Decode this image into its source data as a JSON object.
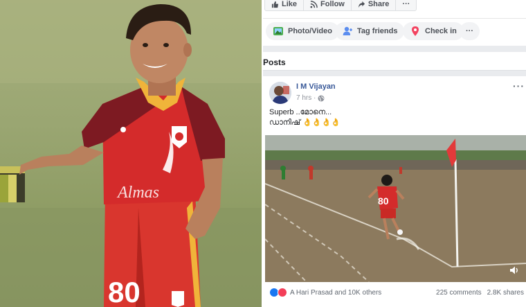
{
  "page_actions": {
    "like": "Like",
    "follow": "Follow",
    "share": "Share",
    "more": "···"
  },
  "composer": {
    "photo_video": "Photo/Video",
    "tag_friends": "Tag friends",
    "check_in": "Check in",
    "more": "···"
  },
  "posts_section": {
    "title": "Posts"
  },
  "post": {
    "author": "I M Vijayan",
    "time": "7 hrs · ",
    "menu": "···",
    "text_line1": "Superb ..മോനെ...",
    "text_line2": "ഡാനിഷ് 👌👌👌👌",
    "reactions_text": "A Hari Prasad and 10K others",
    "comments": "225 comments",
    "shares": "2.8K shares"
  },
  "video_overlay": {
    "jersey_number": "80"
  },
  "photo_overlay": {
    "jersey_number": "80",
    "shirt_text": "Almas"
  },
  "colors": {
    "fb_blue": "#385898",
    "like_blue": "#1877f2",
    "love_red": "#f33e58",
    "jersey_red": "#d42b2b",
    "jersey_maroon": "#7d1a22",
    "jersey_gold": "#f0b43a"
  },
  "icons": [
    "like-icon",
    "rss-icon",
    "share-icon",
    "photo-icon",
    "tag-friends-icon",
    "check-in-icon",
    "globe-icon",
    "volume-icon"
  ]
}
